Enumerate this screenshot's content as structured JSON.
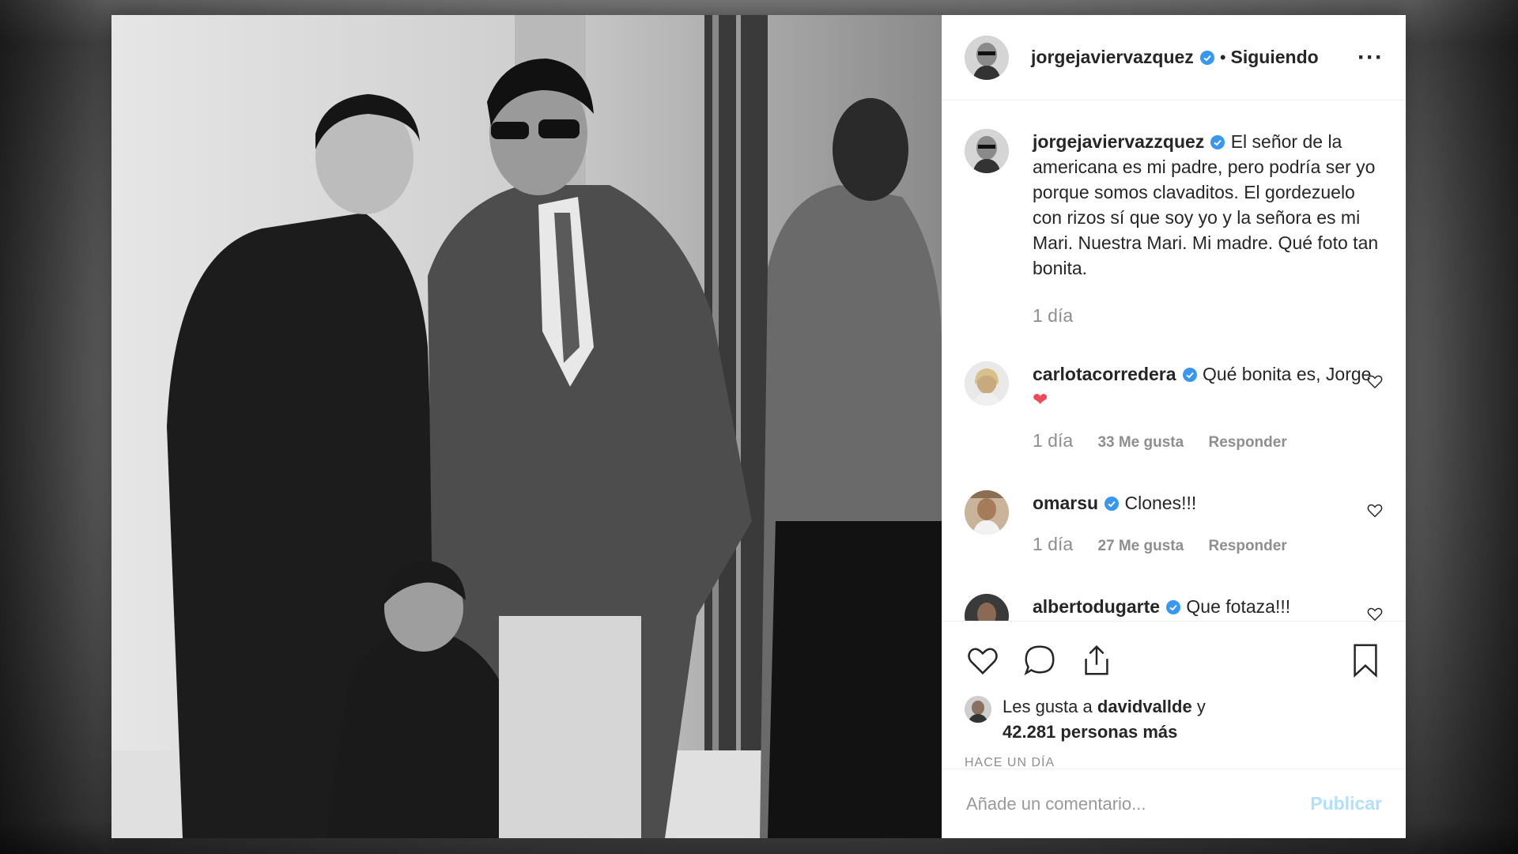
{
  "post": {
    "username": "jorgejaviervazquez",
    "follow_status": "Siguiendo",
    "separator": "•",
    "more": "···"
  },
  "caption": {
    "username": "jorgejaviervazzquez",
    "text": "El señor de la americana es mi padre, pero podría ser yo porque somos clavaditos. El gordezuelo con rizos sí que soy yo y la señora es mi Mari. Nuestra Mari. Mi madre. Qué foto tan bonita.",
    "time": "1 día"
  },
  "comments": [
    {
      "username": "carlotacorredera",
      "text": "Qué bonita es, Jorge",
      "emoji": "❤",
      "time": "1 día",
      "likes": "33 Me gusta",
      "reply": "Responder"
    },
    {
      "username": "omarsu",
      "text": "Clones!!!",
      "time": "1 día",
      "likes": "27 Me gusta",
      "reply": "Responder"
    },
    {
      "username": "albertodugarte",
      "text": "Que fotaza!!!"
    }
  ],
  "likes": {
    "prefix": "Les gusta a",
    "user": "davidvallde",
    "conj": "y",
    "count": "42.281 personas más"
  },
  "timestamp": "HACE UN DÍA",
  "add_comment": {
    "placeholder": "Añade un comentario...",
    "publish": "Publicar"
  },
  "colors": {
    "verified": "#3897f0",
    "heart": "#ed4956",
    "publish_disabled": "#b2dffc"
  },
  "icons": [
    "like-icon",
    "comment-icon",
    "share-icon",
    "bookmark-icon",
    "verified-icon",
    "more-icon"
  ]
}
